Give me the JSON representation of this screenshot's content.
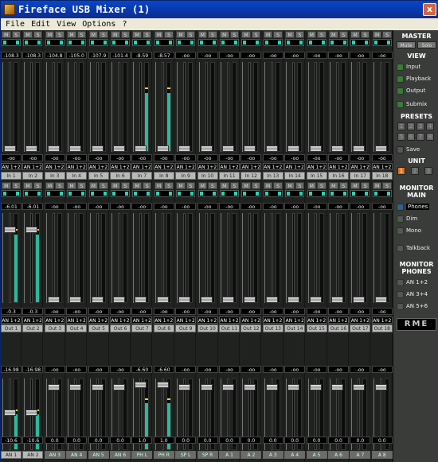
{
  "window": {
    "title": "Fireface USB Mixer (1)",
    "close": "x"
  },
  "menu": [
    "File",
    "Edit",
    "View",
    "Options",
    "?"
  ],
  "ms": {
    "m": "M",
    "s": "S"
  },
  "inputs": {
    "top_values": [
      "-108.3",
      "-108.3",
      "-104.8",
      "-105.0",
      "-107.9",
      "-101.4",
      "-8.59",
      "-8.57",
      "-oo",
      "-oo",
      "-oo",
      "-oo",
      "-oo",
      "-oo",
      "-oo",
      "-oo",
      "-oo",
      "-oo"
    ],
    "fader_values": [
      "-oo",
      "-oo",
      "-oo",
      "-oo",
      "-oo",
      "-oo",
      "-oo",
      "-oo",
      "-oo",
      "-oo",
      "-oo",
      "-oo",
      "-oo",
      "-oo",
      "-oo",
      "-oo",
      "-oo",
      "-oo"
    ],
    "routes": [
      "AN 1+2",
      "AN 1+2",
      "AN 1+2",
      "AN 1+2",
      "AN 1+2",
      "AN 1+2",
      "AN 1+2",
      "AN 1+2",
      "AN 1+2",
      "AN 1+2",
      "AN 1+2",
      "AN 1+2",
      "AN 1+2",
      "AN 1+2",
      "AN 1+2",
      "AN 1+2",
      "AN 1+2",
      "AN 1+2"
    ],
    "names": [
      "In 1",
      "In 2",
      "In 3",
      "In 4",
      "In 5",
      "In 6",
      "In 7",
      "In 8",
      "In 9",
      "In 10",
      "In 11",
      "In 12",
      "In 13",
      "In 14",
      "In 15",
      "In 16",
      "In 17",
      "In 18"
    ],
    "meter_levels": [
      0,
      0,
      0,
      0,
      0,
      0,
      0.66,
      0.66,
      0,
      0,
      0,
      0,
      0,
      0,
      0,
      0,
      0,
      0
    ],
    "fader_levels": [
      0,
      0,
      0,
      0,
      0,
      0,
      0,
      0,
      0,
      0,
      0,
      0,
      0,
      0,
      0,
      0,
      0,
      0
    ]
  },
  "playback": {
    "top_values": [
      "-6.01",
      "-6.01",
      "-oo",
      "-oo",
      "-oo",
      "-oo",
      "-oo",
      "-oo",
      "-oo",
      "-oo",
      "-oo",
      "-oo",
      "-oo",
      "-oo",
      "-oo",
      "-oo",
      "-oo",
      "-oo"
    ],
    "fader_values": [
      "-0.3",
      "-0.3",
      "-oo",
      "-oo",
      "-oo",
      "-oo",
      "-oo",
      "-oo",
      "-oo",
      "-oo",
      "-oo",
      "-oo",
      "-oo",
      "-oo",
      "-oo",
      "-oo",
      "-oo",
      "-oo"
    ],
    "routes": [
      "AN 1+2",
      "AN 1+2",
      "AN 1+2",
      "AN 1+2",
      "AN 1+2",
      "AN 1+2",
      "AN 1+2",
      "AN 1+2",
      "AN 1+2",
      "AN 1+2",
      "AN 1+2",
      "AN 1+2",
      "AN 1+2",
      "AN 1+2",
      "AN 1+2",
      "AN 1+2",
      "AN 1+2",
      "AN 1+2"
    ],
    "names": [
      "Out 1",
      "Out 2",
      "Out 3",
      "Out 4",
      "Out 5",
      "Out 6",
      "Out 7",
      "Out 8",
      "Out 9",
      "Out 10",
      "Out 11",
      "Out 12",
      "Out 13",
      "Out 14",
      "Out 15",
      "Out 16",
      "Out 17",
      "Out 18"
    ],
    "meter_levels": [
      0.77,
      0.77,
      0,
      0,
      0,
      0,
      0,
      0,
      0,
      0,
      0,
      0,
      0,
      0,
      0,
      0,
      0,
      0
    ],
    "fader_levels": [
      0.84,
      0.84,
      0,
      0,
      0,
      0,
      0,
      0,
      0,
      0,
      0,
      0,
      0,
      0,
      0,
      0,
      0,
      0
    ]
  },
  "outputs": {
    "top_values": [
      "-16.98",
      "-16.98",
      "-oo",
      "-oo",
      "-oo",
      "-oo",
      "-6.60",
      "-6.60",
      "-oo",
      "-oo",
      "-oo",
      "-oo",
      "-oo",
      "-oo",
      "-oo",
      "-oo",
      "-oo",
      "-oo"
    ],
    "fader_values": [
      "-10.6",
      "-10.6",
      "0.0",
      "0.0",
      "0.0",
      "0.0",
      "1.0",
      "1.0",
      "0.0",
      "0.0",
      "0.0",
      "0.0",
      "0.0",
      "0.0",
      "0.0",
      "0.0",
      "0.0",
      "0.0"
    ],
    "names": [
      "AN 1",
      "AN 2",
      "AN 3",
      "AN 4",
      "AN 5",
      "AN 6",
      "PH L",
      "PH R",
      "SP L",
      "SP R",
      "A 1",
      "A 2",
      "A 3",
      "A 4",
      "A 5",
      "A 6",
      "A 7",
      "A 8"
    ],
    "active": [
      true,
      true,
      false,
      false,
      false,
      false,
      false,
      false,
      false,
      false,
      false,
      false,
      false,
      false,
      false,
      false,
      false,
      false
    ],
    "meter_levels": [
      0.5,
      0.5,
      0,
      0,
      0,
      0,
      0.66,
      0.66,
      0,
      0,
      0,
      0,
      0,
      0,
      0,
      0,
      0,
      0
    ],
    "fader_levels": [
      0.52,
      0.52,
      0.92,
      0.92,
      0.92,
      0.92,
      0.95,
      0.95,
      0.92,
      0.92,
      0.92,
      0.92,
      0.92,
      0.92,
      0.92,
      0.92,
      0.92,
      0.92
    ]
  },
  "side": {
    "master": "MASTER",
    "mute": "Mute",
    "solo": "Solo",
    "view": "VIEW",
    "view_items": [
      "Input",
      "Playback",
      "Output",
      "Submix"
    ],
    "presets": "PRESETS",
    "preset_nums": [
      "1",
      "2",
      "3",
      "4",
      "5",
      "6",
      "7",
      "8"
    ],
    "save": "Save",
    "unit": "UNIT",
    "unit_nums": [
      "1",
      "2",
      "3"
    ],
    "monitor_main": "MONITOR MAIN",
    "main_items": [
      "Phones",
      "Dim",
      "Mono"
    ],
    "talkback": "Talkback",
    "monitor_phones": "MONITOR PHONES",
    "phones_items": [
      "AN 1+2",
      "AN 3+4",
      "AN 5+6"
    ],
    "logo": "RME"
  },
  "colors": {
    "meter": "#2eb89c",
    "peak_mark": "#2ad4b4",
    "unit_active": "#e07020"
  }
}
